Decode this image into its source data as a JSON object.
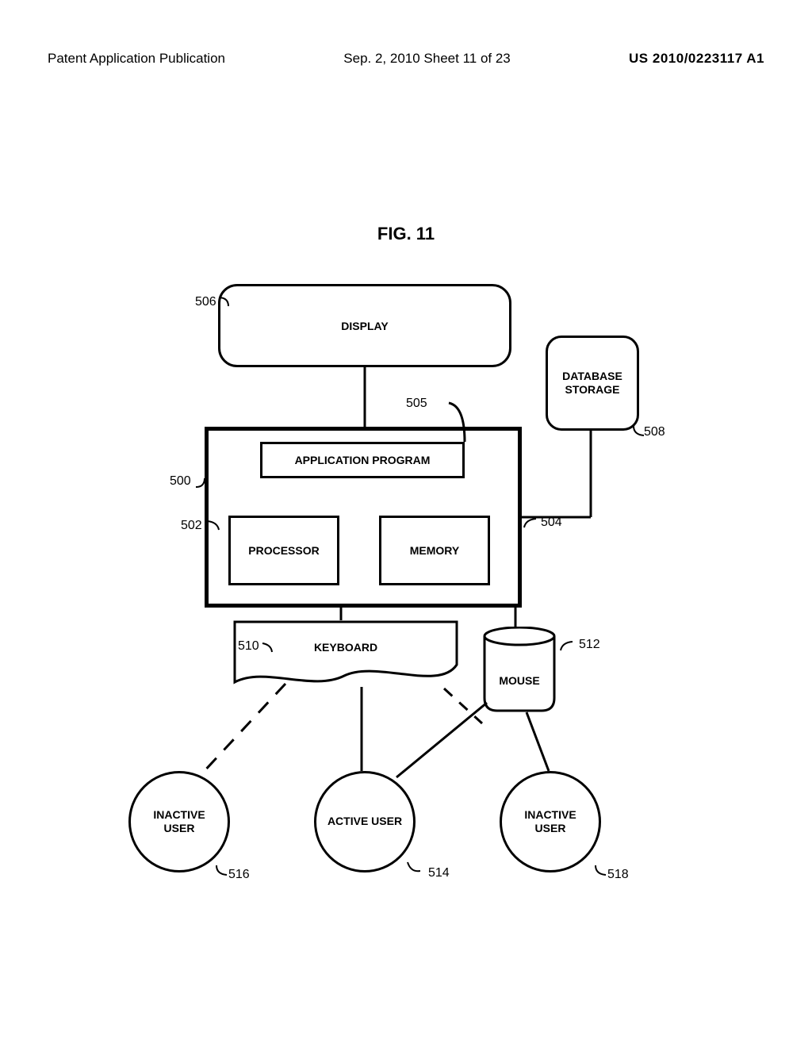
{
  "header": {
    "left": "Patent Application Publication",
    "center": "Sep. 2, 2010  Sheet 11 of 23",
    "right": "US 2010/0223117 A1"
  },
  "figure_title": "FIG. 11",
  "blocks": {
    "display": "DISPLAY",
    "database_storage": "DATABASE\nSTORAGE",
    "application_program": "APPLICATION PROGRAM",
    "processor": "PROCESSOR",
    "memory": "MEMORY",
    "keyboard": "KEYBOARD",
    "mouse": "MOUSE"
  },
  "users": {
    "inactive_left": "INACTIVE\nUSER",
    "active": "ACTIVE USER",
    "inactive_right": "INACTIVE\nUSER"
  },
  "refs": {
    "r500": "500",
    "r502": "502",
    "r504": "504",
    "r505": "505",
    "r506": "506",
    "r508": "508",
    "r510": "510",
    "r512": "512",
    "r514": "514",
    "r516": "516",
    "r518": "518"
  }
}
